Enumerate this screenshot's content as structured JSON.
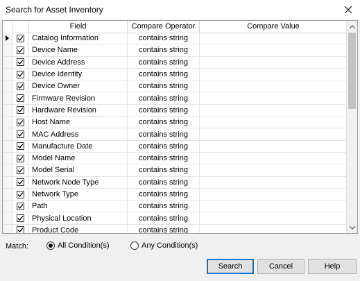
{
  "window": {
    "title": "Search for Asset Inventory"
  },
  "grid": {
    "columns": {
      "field": "Field",
      "operator": "Compare Operator",
      "value": "Compare Value"
    },
    "rows": [
      {
        "field": "Catalog Information",
        "operator": "contains string",
        "value": ""
      },
      {
        "field": "Device Name",
        "operator": "contains string",
        "value": ""
      },
      {
        "field": "Device Address",
        "operator": "contains string",
        "value": ""
      },
      {
        "field": "Device Identity",
        "operator": "contains string",
        "value": ""
      },
      {
        "field": "Device Owner",
        "operator": "contains string",
        "value": ""
      },
      {
        "field": "Firmware Revision",
        "operator": "contains string",
        "value": ""
      },
      {
        "field": "Hardware Revision",
        "operator": "contains string",
        "value": ""
      },
      {
        "field": "Host Name",
        "operator": "contains string",
        "value": ""
      },
      {
        "field": "MAC Address",
        "operator": "contains string",
        "value": ""
      },
      {
        "field": "Manufacture Date",
        "operator": "contains string",
        "value": ""
      },
      {
        "field": "Model Name",
        "operator": "contains string",
        "value": ""
      },
      {
        "field": "Model Serial",
        "operator": "contains string",
        "value": ""
      },
      {
        "field": "Network Node Type",
        "operator": "contains string",
        "value": ""
      },
      {
        "field": "Network Type",
        "operator": "contains string",
        "value": ""
      },
      {
        "field": "Path",
        "operator": "contains string",
        "value": ""
      },
      {
        "field": "Physical Location",
        "operator": "contains string",
        "value": ""
      },
      {
        "field": "Product Code",
        "operator": "contains string",
        "value": ""
      }
    ]
  },
  "match": {
    "label": "Match:",
    "options": [
      {
        "label": "All Condition(s)",
        "selected": true
      },
      {
        "label": "Any Condition(s)",
        "selected": false
      }
    ]
  },
  "buttons": {
    "search": "Search",
    "cancel": "Cancel",
    "help": "Help"
  },
  "colors": {
    "primary_border": "#0078d7",
    "grid_line": "#e4e4e4"
  }
}
